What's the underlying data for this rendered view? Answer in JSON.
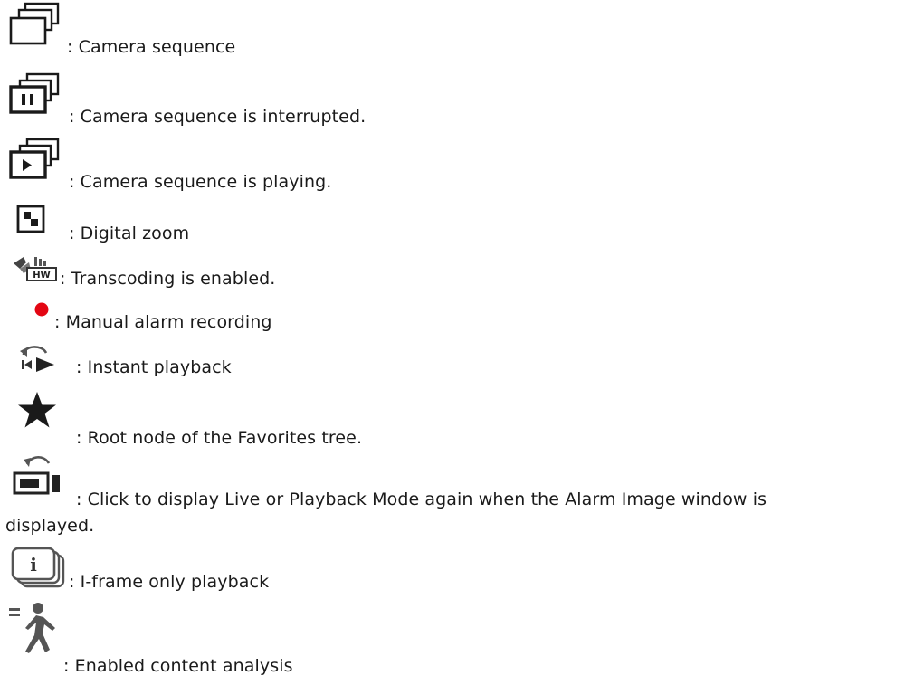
{
  "legend": {
    "items": [
      {
        "icon": "camera-sequence-icon",
        "text": ": Camera sequence"
      },
      {
        "icon": "camera-sequence-paused-icon",
        "text": ": Camera sequence is interrupted."
      },
      {
        "icon": "camera-sequence-playing-icon",
        "text": ": Camera sequence is playing."
      },
      {
        "icon": "digital-zoom-icon",
        "text": ": Digital zoom"
      },
      {
        "icon": "transcoding-hw-icon",
        "text": ": Transcoding is enabled."
      },
      {
        "icon": "record-dot-icon",
        "text": ": Manual alarm recording",
        "color": "#e30613"
      },
      {
        "icon": "instant-playback-icon",
        "text": ": Instant playback"
      },
      {
        "icon": "star-icon",
        "text": ": Root node of the Favorites tree."
      },
      {
        "icon": "back-to-live-icon",
        "text": ": Click to display Live or Playback Mode again when the Alarm Image window is",
        "text_cont": "displayed."
      },
      {
        "icon": "iframe-playback-icon",
        "text": ": I-frame only playback"
      },
      {
        "icon": "content-analysis-icon",
        "text": ": Enabled content analysis"
      }
    ]
  }
}
